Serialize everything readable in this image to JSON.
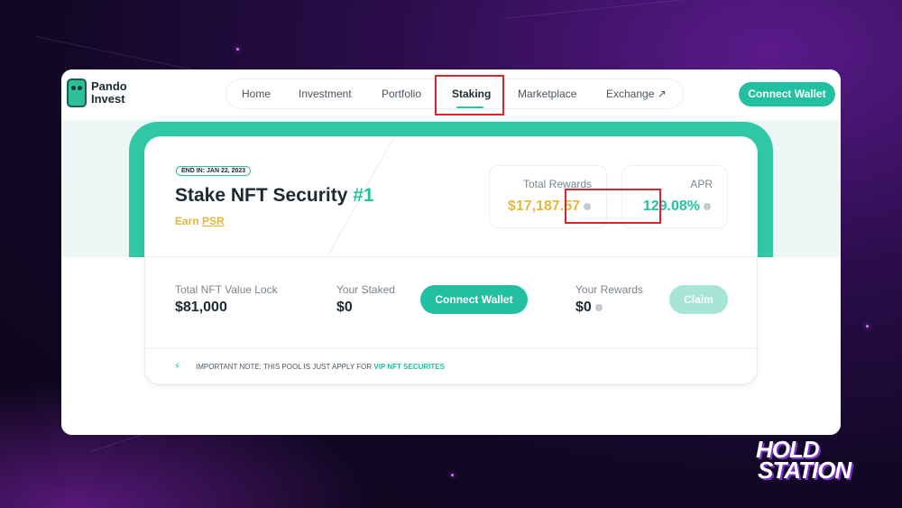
{
  "app": {
    "logo_lines": [
      "Pando",
      "Invest"
    ],
    "nav": [
      {
        "label": "Home"
      },
      {
        "label": "Investment"
      },
      {
        "label": "Portfolio"
      },
      {
        "label": "Staking",
        "active": true
      },
      {
        "label": "Marketplace"
      },
      {
        "label": "Exchange ↗"
      }
    ],
    "connect_wallet_label": "Connect Wallet"
  },
  "pool": {
    "end_badge": "END IN: JAN 22, 2023",
    "title": "Stake NFT Security",
    "title_number": "#1",
    "earn_prefix": "Earn",
    "earn_token": "PSR",
    "total_rewards_label": "Total Rewards",
    "total_rewards_value": "$17,187.57",
    "apr_label": "APR",
    "apr_value": "129.08%",
    "total_nft_label": "Total NFT Value Lock",
    "total_nft_value": "$81,000",
    "your_staked_label": "Your Staked",
    "your_staked_value": "$0",
    "connect_wallet_label": "Connect Wallet",
    "your_rewards_label": "Your Rewards",
    "your_rewards_value": "$0",
    "claim_label": "Claim",
    "note_text": "IMPORTANT NOTE: THIS POOL IS JUST APPLY FOR",
    "note_link": "VIP NFT SECURITES"
  },
  "brand": {
    "lines": [
      "HOLD",
      "STATION"
    ]
  },
  "colors": {
    "accent": "#22c0a0",
    "gold": "#e5b73b",
    "highlight_box": "#d8262f"
  }
}
